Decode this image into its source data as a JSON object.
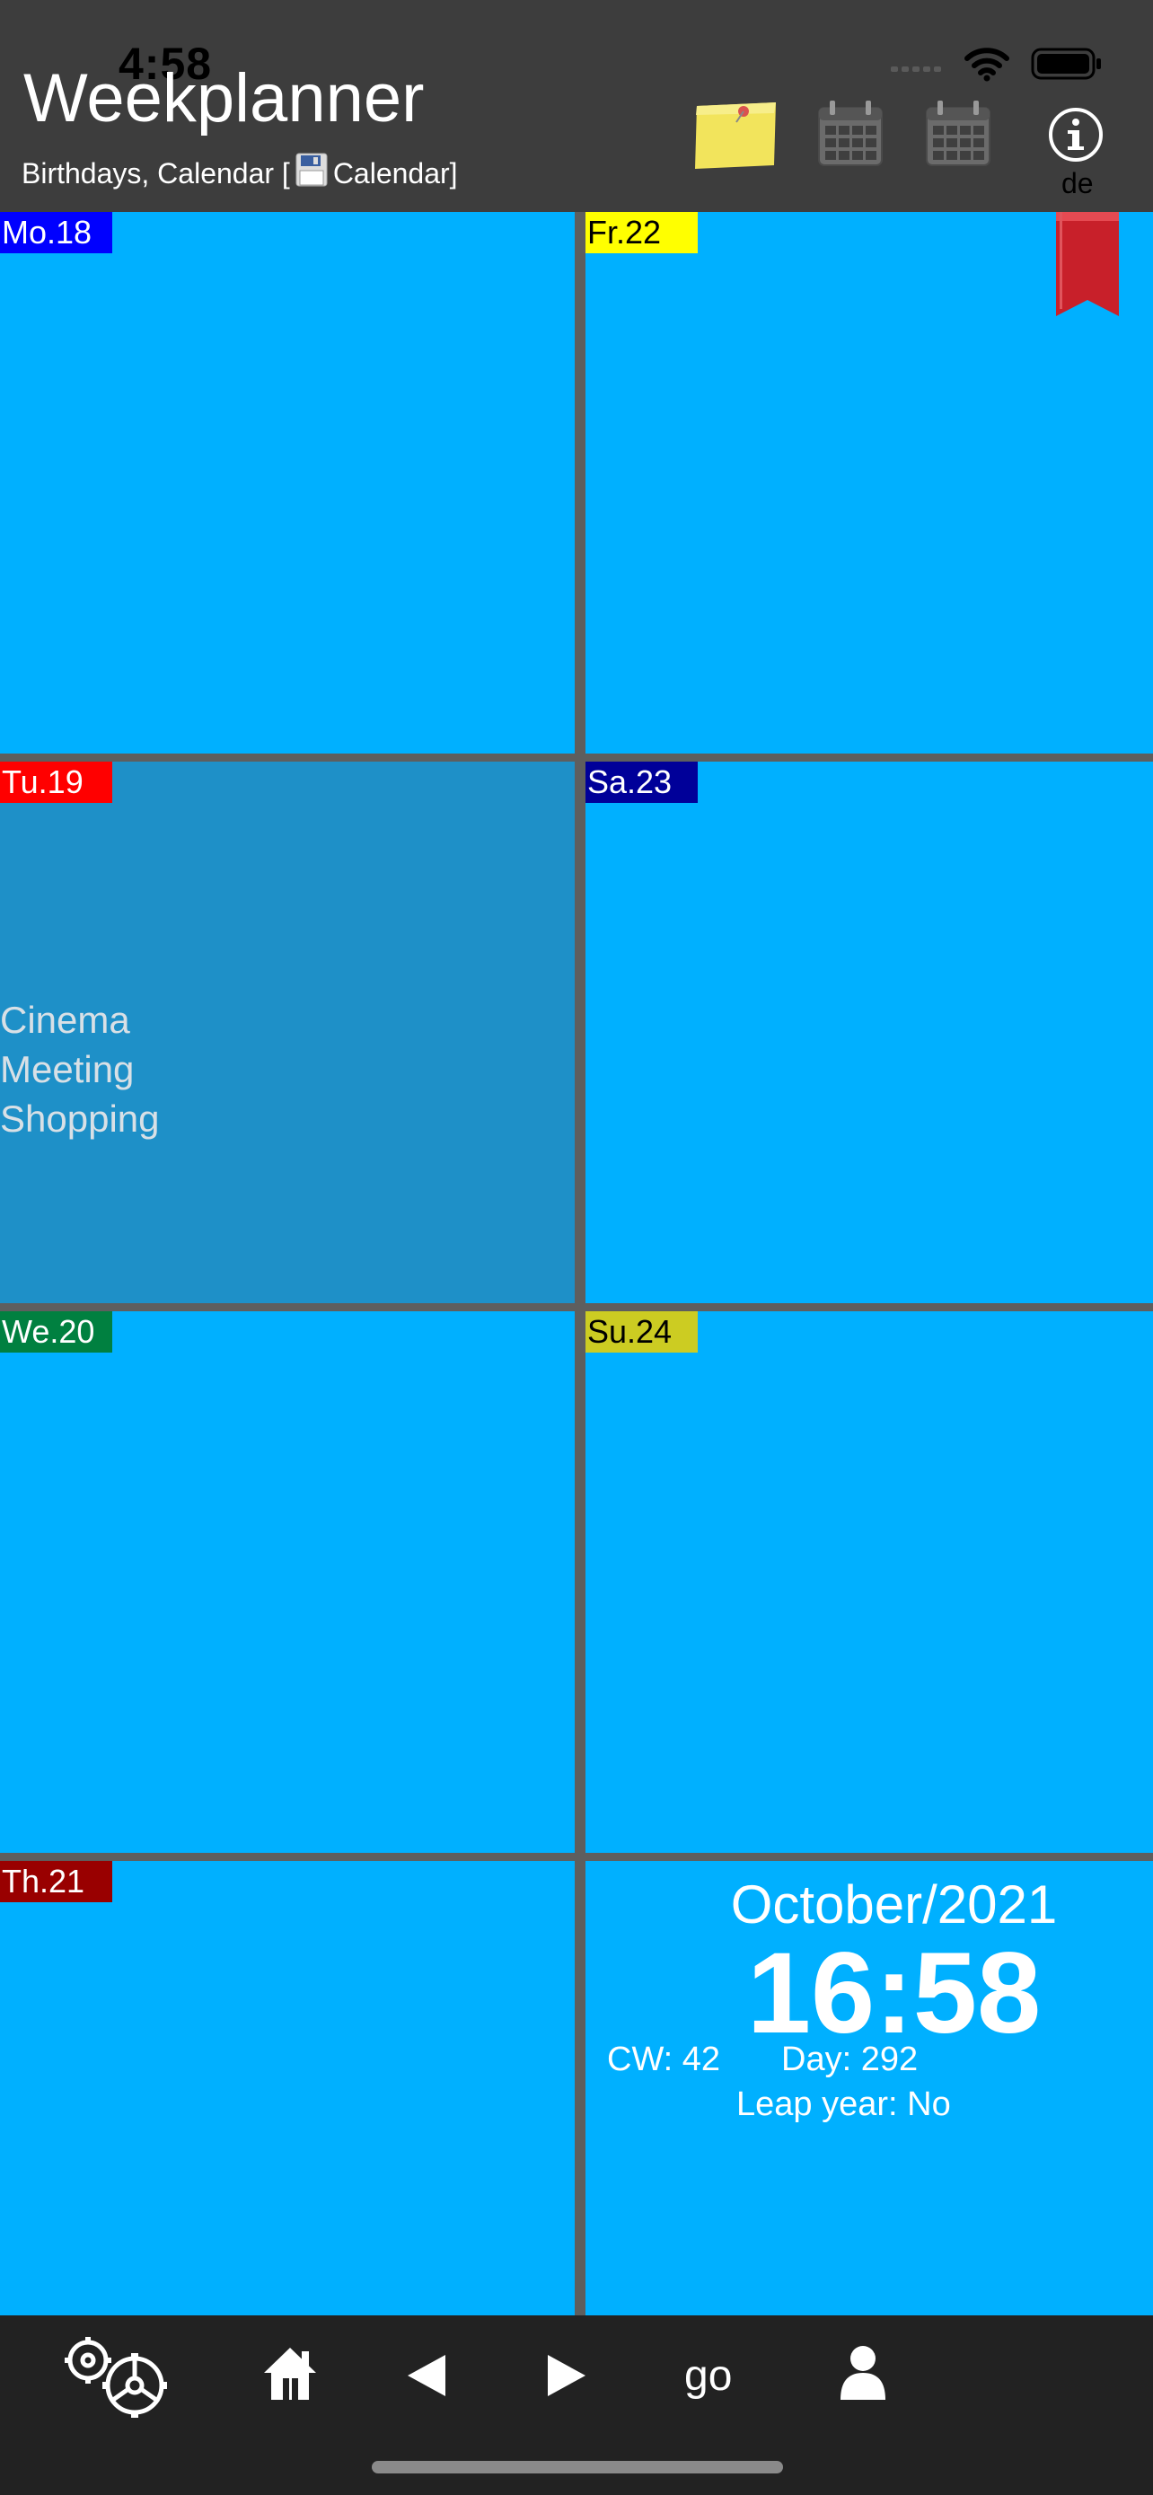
{
  "status_bar": {
    "time": "4:58"
  },
  "header": {
    "title": "Weekplanner",
    "subtitle_prefix": "Birthdays, Calendar [",
    "subtitle_suffix": " Calendar]",
    "language": "de",
    "icons": [
      "sticky-note-icon",
      "calendar-icon",
      "calendar-icon",
      "info-icon"
    ]
  },
  "days": [
    {
      "label": "Mo.18",
      "label_bg": "#0000ff",
      "label_color": "#ffffff",
      "events": []
    },
    {
      "label": "Tu.19",
      "label_bg": "#ff0000",
      "label_color": "#ffffff",
      "events": [
        "Cinema",
        "Meeting",
        "Shopping"
      ]
    },
    {
      "label": "We.20",
      "label_bg": "#008040",
      "label_color": "#ffffff",
      "events": []
    },
    {
      "label": "Th.21",
      "label_bg": "#990000",
      "label_color": "#ffffff",
      "events": []
    },
    {
      "label": "Fr.22",
      "label_bg": "#ffff00",
      "label_color": "#000000",
      "events": []
    },
    {
      "label": "Sa.23",
      "label_bg": "#000099",
      "label_color": "#ffffff",
      "events": []
    },
    {
      "label": "Su.24",
      "label_bg": "#cccc22",
      "label_color": "#000000",
      "events": []
    }
  ],
  "info": {
    "month_year": "October/2021",
    "clock": "16:58",
    "cw": "CW: 42",
    "day": "Day: 292",
    "leap_year": "Leap year: No"
  },
  "toolbar": {
    "icons": [
      "settings-icon",
      "home-icon",
      "previous-icon",
      "next-icon",
      "go-button",
      "person-icon"
    ],
    "go_label": "go"
  },
  "colors": {
    "cell": "#00b0ff",
    "cell_active": "#1e90c8",
    "grid_line": "#5e5e5e",
    "header": "#3d3d3d",
    "toolbar": "#222222"
  }
}
